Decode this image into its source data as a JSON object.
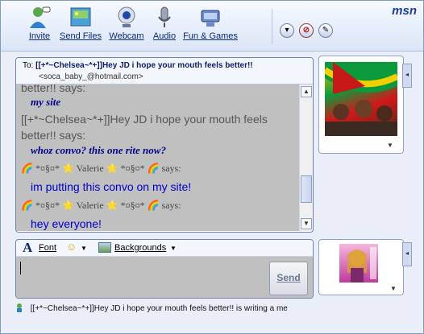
{
  "toolbar": {
    "buttons": [
      {
        "label": "Invite",
        "icon": "invite-person-icon"
      },
      {
        "label": "Send Files",
        "icon": "send-files-icon"
      },
      {
        "label": "Webcam",
        "icon": "webcam-icon"
      },
      {
        "label": "Audio",
        "icon": "microphone-icon"
      },
      {
        "label": "Fun & Games",
        "icon": "games-icon"
      }
    ],
    "brand": "msn"
  },
  "conversation": {
    "to_label": "To:",
    "to_name": "[[+*~Chelsea~*+]]Hey JD i hope your mouth feels better!!",
    "to_email": "<soca_baby_@hotmail.com>",
    "history": [
      {
        "kind": "gray",
        "text": "better!! says:"
      },
      {
        "kind": "italic",
        "text": "my site"
      },
      {
        "kind": "gray",
        "text": "[[+*~Chelsea~*+]]Hey JD i hope your mouth feels"
      },
      {
        "kind": "gray",
        "text": "better!! says:"
      },
      {
        "kind": "italic",
        "text": "whoz convo? this one rite now?"
      },
      {
        "kind": "nick",
        "text": "🌈 *¤§¤* ⭐ Valerie ⭐ *¤§¤* 🌈  says:"
      },
      {
        "kind": "msg",
        "text": "im putting this convo on my site!"
      },
      {
        "kind": "nick",
        "text": "🌈 *¤§¤* ⭐ Valerie ⭐ *¤§¤* 🌈  says:"
      },
      {
        "kind": "msg",
        "text": "hey everyone!"
      }
    ]
  },
  "format_bar": {
    "font_label": "Font",
    "backgrounds_label": "Backgrounds"
  },
  "input": {
    "value": "",
    "send_label": "Send"
  },
  "status": {
    "text": "[[+*~Chelsea~*+]]Hey JD i hope your mouth feels better!! is writing a me"
  },
  "colors": {
    "accent": "#0a2a7a",
    "history_bg": "#c0c0c0",
    "message_blue": "#0000cc"
  }
}
